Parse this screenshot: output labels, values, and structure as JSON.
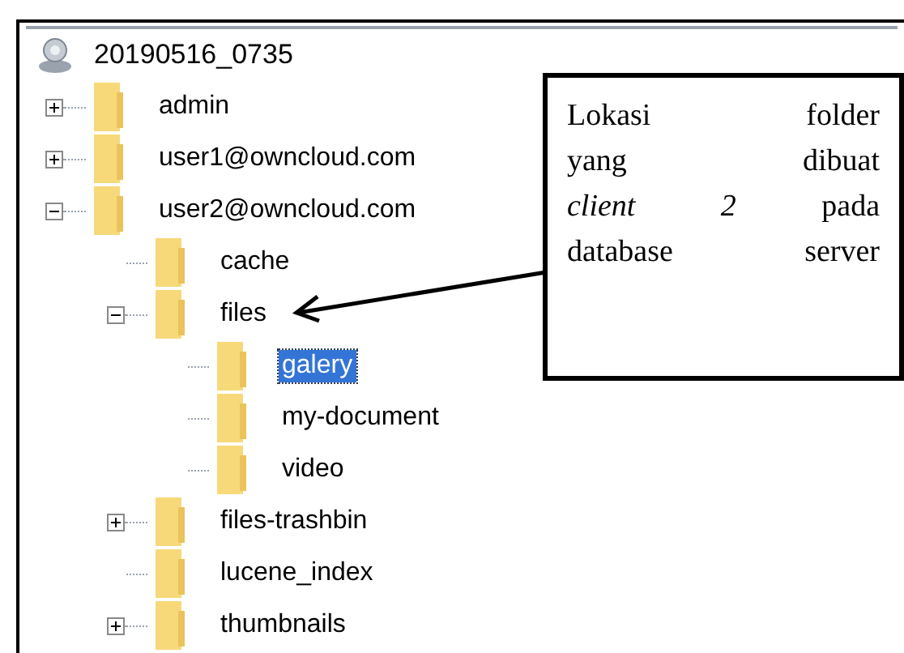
{
  "tree": {
    "label": "20190516_0735",
    "children": [
      {
        "label": "admin",
        "kind": "collapsed",
        "selected": false
      },
      {
        "label": "user1@owncloud.com",
        "kind": "collapsed",
        "selected": false
      },
      {
        "label": "user2@owncloud.com",
        "kind": "expanded",
        "selected": false,
        "children": [
          {
            "label": "cache",
            "kind": "leaf",
            "selected": false
          },
          {
            "label": "files",
            "kind": "expanded",
            "selected": false,
            "children": [
              {
                "label": "galery",
                "kind": "leaf",
                "selected": true
              },
              {
                "label": "my-document",
                "kind": "leaf",
                "selected": false
              },
              {
                "label": "video",
                "kind": "leaf",
                "selected": false
              }
            ]
          },
          {
            "label": "files-trashbin",
            "kind": "collapsed",
            "selected": false
          },
          {
            "label": "lucene_index",
            "kind": "leaf",
            "selected": false
          },
          {
            "label": "thumbnails",
            "kind": "collapsed",
            "selected": false
          }
        ]
      }
    ]
  },
  "callout": {
    "lines": [
      "Lokasi folder",
      "yang dibuat",
      "*client 2* pada",
      "database server"
    ]
  }
}
